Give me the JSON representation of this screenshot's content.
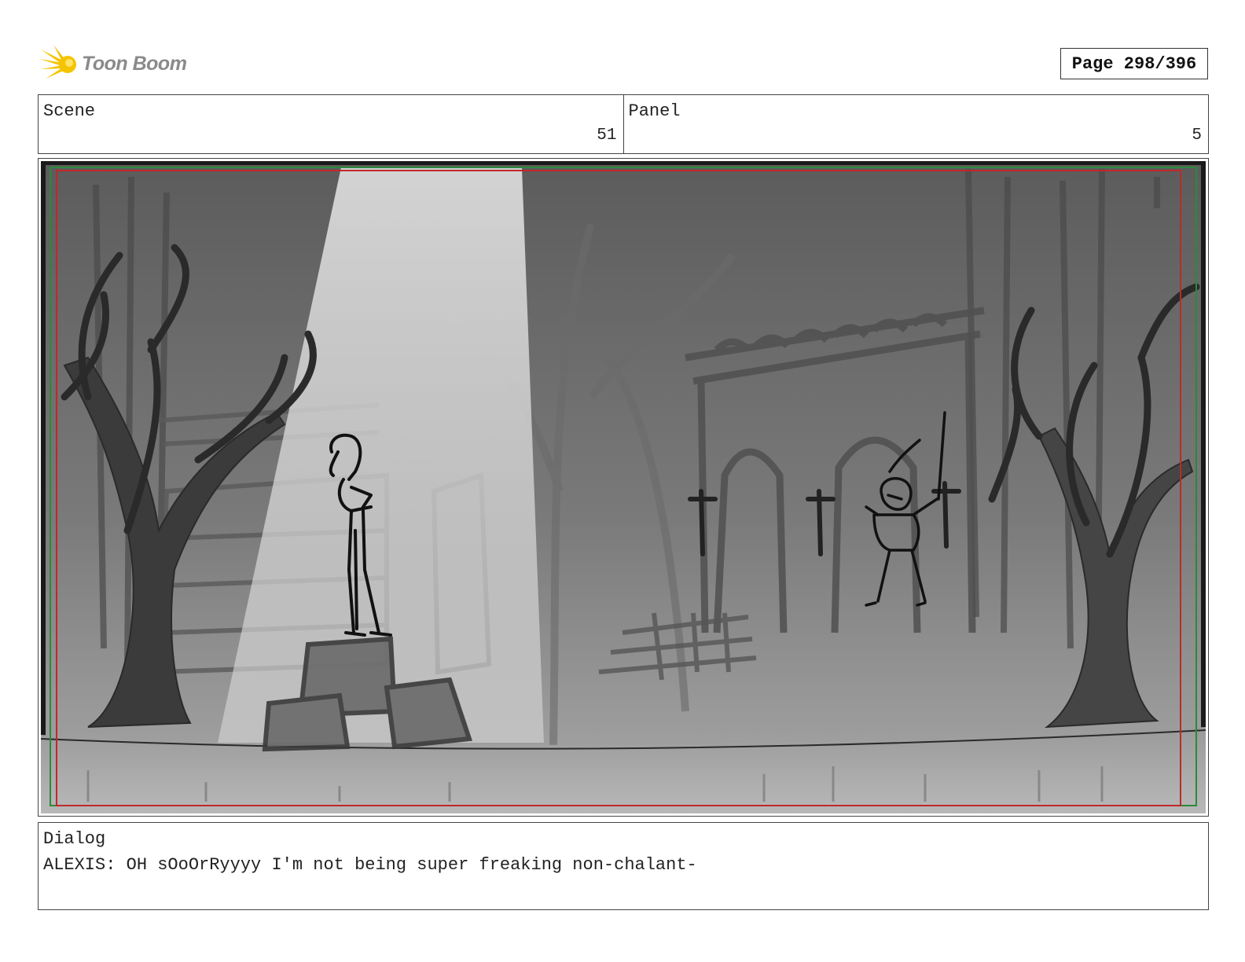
{
  "header": {
    "logo_text": "Toon Boom",
    "page_label": "Page 298/396"
  },
  "info": {
    "scene_label": "Scene",
    "scene_value": "51",
    "panel_label": "Panel",
    "panel_value": "5"
  },
  "dialog": {
    "label": "Dialog",
    "text": "ALEXIS: OH sOoOrRyyyy I'm not being super freaking non-chalant-"
  },
  "colors": {
    "logo_yellow": "#f5c400",
    "logo_gray": "#8a8a8a",
    "safe_frame_red": "#c0282a",
    "safe_frame_green": "#2a8a3a"
  }
}
